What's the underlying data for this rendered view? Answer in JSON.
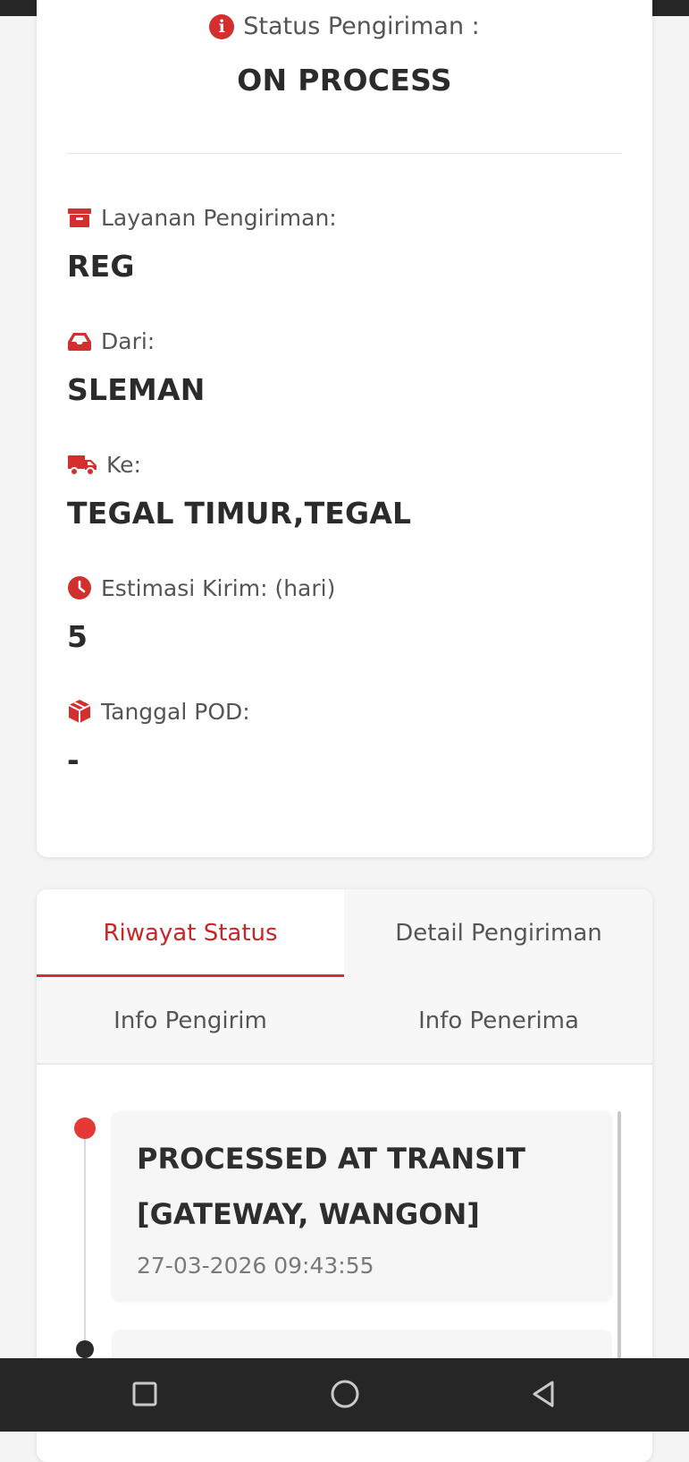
{
  "status": {
    "label": "Status Pengiriman :",
    "value": "ON PROCESS"
  },
  "fields": [
    {
      "icon": "archive-box-icon",
      "label": "Layanan Pengiriman:",
      "value": "REG"
    },
    {
      "icon": "inbox-tray-icon",
      "label": "Dari:",
      "value": "SLEMAN"
    },
    {
      "icon": "truck-icon",
      "label": "Ke:",
      "value": "TEGAL TIMUR,TEGAL"
    },
    {
      "icon": "clock-icon",
      "label": "Estimasi Kirim: (hari)",
      "value": "5"
    },
    {
      "icon": "package-icon",
      "label": "Tanggal POD:",
      "value": "-"
    }
  ],
  "tabs": [
    {
      "label": "Riwayat Status",
      "active": true
    },
    {
      "label": "Detail Pengiriman",
      "active": false
    },
    {
      "label": "Info Pengirim",
      "active": false
    },
    {
      "label": "Info Penerima",
      "active": false
    }
  ],
  "timeline": [
    {
      "title": "PROCESSED AT TRANSIT [GATEWAY, WANGON]",
      "time": "27-03-2026 09:43:55"
    }
  ],
  "colors": {
    "accent": "#d32f2f",
    "text_dark": "#2b2b2b",
    "nav_bar": "#262626"
  },
  "nav": {
    "icons": [
      "recents-square-icon",
      "home-circle-icon",
      "back-triangle-icon"
    ]
  }
}
